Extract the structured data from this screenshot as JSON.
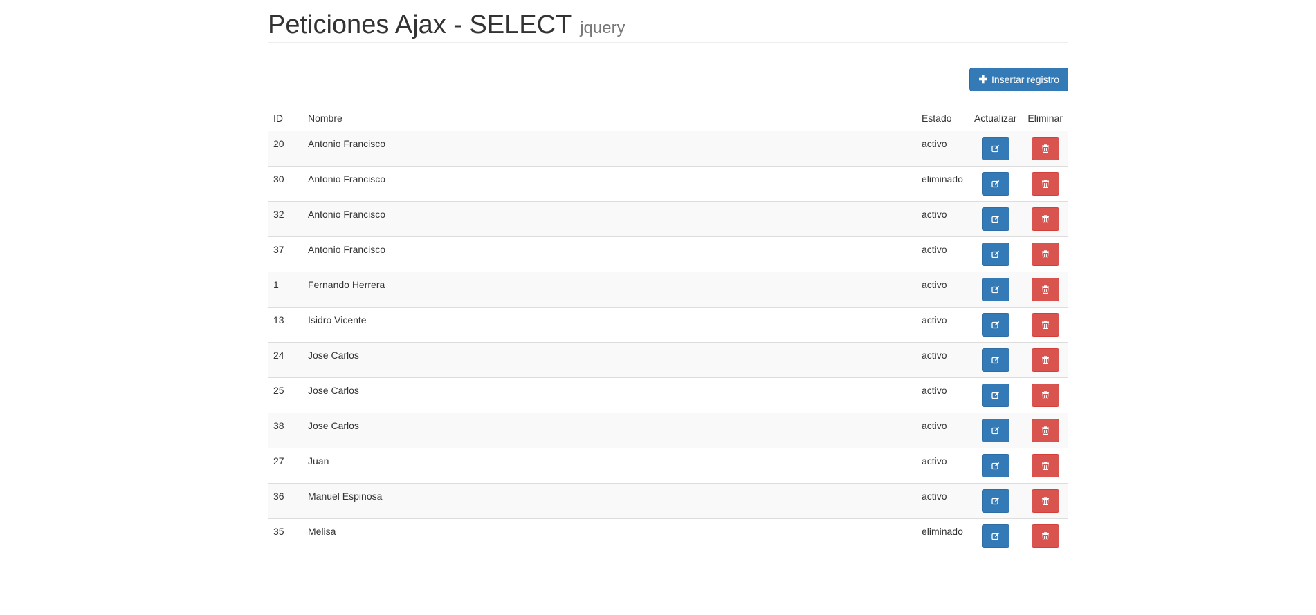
{
  "header": {
    "title": "Peticiones Ajax - SELECT",
    "subtitle": "jquery"
  },
  "toolbar": {
    "insert_label": "Insertar registro",
    "insert_icon": "plus-icon"
  },
  "table": {
    "columns": [
      "ID",
      "Nombre",
      "Estado",
      "Actualizar",
      "Eliminar"
    ],
    "rows": [
      {
        "id": "20",
        "nombre": "Antonio Francisco",
        "estado": "activo"
      },
      {
        "id": "30",
        "nombre": "Antonio Francisco",
        "estado": "eliminado"
      },
      {
        "id": "32",
        "nombre": "Antonio Francisco",
        "estado": "activo"
      },
      {
        "id": "37",
        "nombre": "Antonio Francisco",
        "estado": "activo"
      },
      {
        "id": "1",
        "nombre": "Fernando Herrera",
        "estado": "activo"
      },
      {
        "id": "13",
        "nombre": "Isidro Vicente",
        "estado": "activo"
      },
      {
        "id": "24",
        "nombre": "Jose Carlos",
        "estado": "activo"
      },
      {
        "id": "25",
        "nombre": "Jose Carlos",
        "estado": "activo"
      },
      {
        "id": "38",
        "nombre": "Jose Carlos",
        "estado": "activo"
      },
      {
        "id": "27",
        "nombre": "Juan",
        "estado": "activo"
      },
      {
        "id": "36",
        "nombre": "Manuel Espinosa",
        "estado": "activo"
      },
      {
        "id": "35",
        "nombre": "Melisa",
        "estado": "eliminado"
      }
    ],
    "edit_icon": "edit-icon",
    "delete_icon": "trash-icon"
  },
  "colors": {
    "primary": "#337ab7",
    "danger": "#d9534f"
  }
}
